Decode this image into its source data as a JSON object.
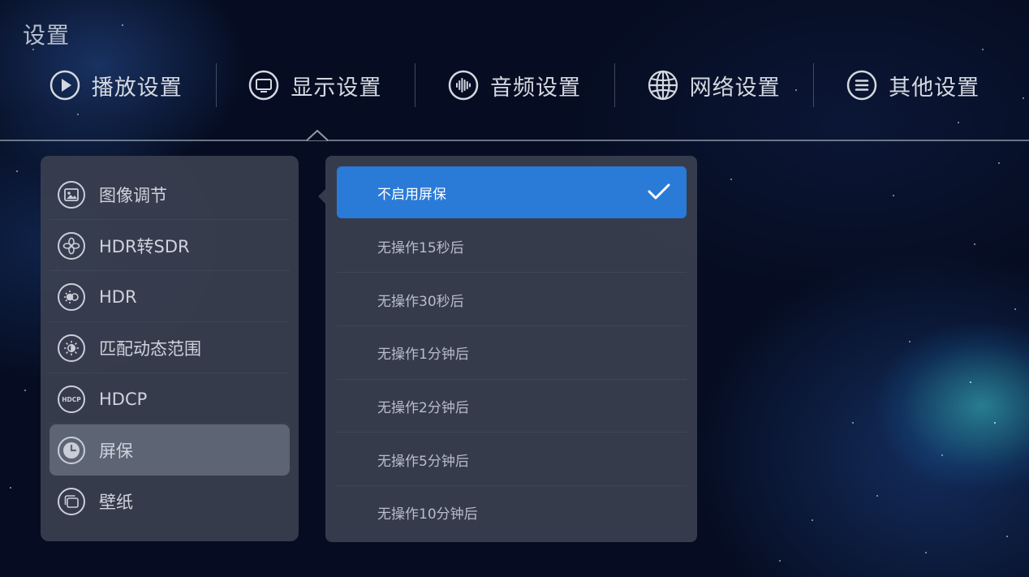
{
  "page": {
    "title": "设置"
  },
  "tabs": [
    {
      "label": "播放设置",
      "icon": "play-icon"
    },
    {
      "label": "显示设置",
      "icon": "monitor-icon",
      "active": true
    },
    {
      "label": "音频设置",
      "icon": "audio-wave-icon"
    },
    {
      "label": "网络设置",
      "icon": "globe-icon"
    },
    {
      "label": "其他设置",
      "icon": "menu-lines-icon"
    }
  ],
  "display_menu": {
    "items": [
      {
        "label": "图像调节",
        "icon": "image-adjust-icon"
      },
      {
        "label": "HDR转SDR",
        "icon": "hdr-to-sdr-icon"
      },
      {
        "label": "HDR",
        "icon": "hdr-icon"
      },
      {
        "label": "匹配动态范围",
        "icon": "brightness-icon"
      },
      {
        "label": "HDCP",
        "icon": "hdcp-icon",
        "icon_text": "HDCP"
      },
      {
        "label": "屏保",
        "icon": "clock-icon",
        "active": true
      },
      {
        "label": "壁纸",
        "icon": "wallpaper-icon"
      }
    ]
  },
  "screensaver_options": {
    "items": [
      {
        "label": "不启用屏保",
        "selected": true
      },
      {
        "label": "无操作15秒后"
      },
      {
        "label": "无操作30秒后"
      },
      {
        "label": "无操作1分钟后"
      },
      {
        "label": "无操作2分钟后"
      },
      {
        "label": "无操作5分钟后"
      },
      {
        "label": "无操作10分钟后"
      }
    ]
  },
  "colors": {
    "accent": "#2a7ad8",
    "panel": "#3a4050",
    "active_item": "#606676",
    "background": "#060d22"
  }
}
